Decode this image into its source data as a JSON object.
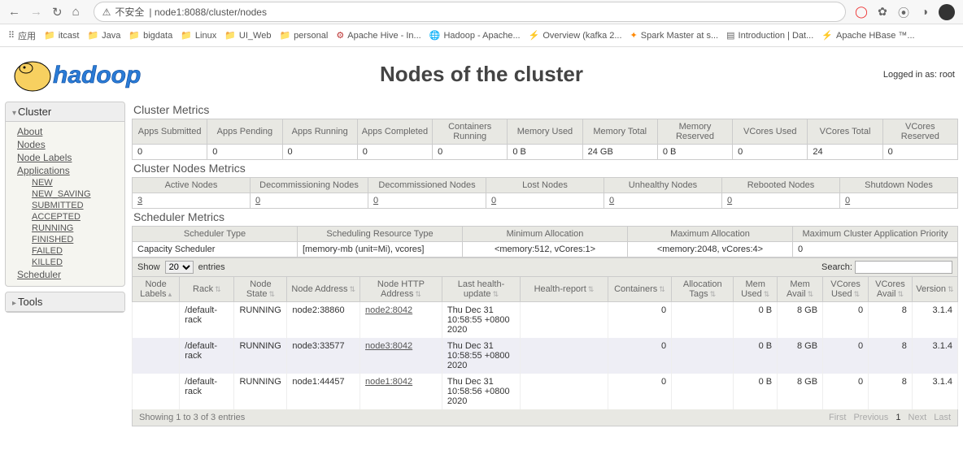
{
  "browser": {
    "url_warn_text": "不安全",
    "url": "node1:8088/cluster/nodes",
    "bookmarks_app": "应用",
    "bookmarks": [
      "itcast",
      "Java",
      "bigdata",
      "Linux",
      "UI_Web",
      "personal",
      "Apache Hive - In...",
      "Hadoop - Apache...",
      "Overview (kafka 2...",
      "Spark Master at s...",
      "Introduction | Dat...",
      "Apache HBase ™..."
    ]
  },
  "page": {
    "title": "Nodes of the cluster",
    "login": "Logged in as: root"
  },
  "sidebar": {
    "cluster_head": "Cluster",
    "cluster_links": [
      "About",
      "Nodes",
      "Node Labels",
      "Applications"
    ],
    "app_states": [
      "NEW",
      "NEW_SAVING",
      "SUBMITTED",
      "ACCEPTED",
      "RUNNING",
      "FINISHED",
      "FAILED",
      "KILLED"
    ],
    "scheduler": "Scheduler",
    "tools_head": "Tools"
  },
  "sections": {
    "cluster_metrics": "Cluster Metrics",
    "cluster_nodes": "Cluster Nodes Metrics",
    "scheduler_metrics": "Scheduler Metrics"
  },
  "cluster_metrics": {
    "headers": [
      "Apps Submitted",
      "Apps Pending",
      "Apps Running",
      "Apps Completed",
      "Containers Running",
      "Memory Used",
      "Memory Total",
      "Memory Reserved",
      "VCores Used",
      "VCores Total",
      "VCores Reserved"
    ],
    "values": [
      "0",
      "0",
      "0",
      "0",
      "0",
      "0 B",
      "24 GB",
      "0 B",
      "0",
      "24",
      "0"
    ]
  },
  "nodes_metrics": {
    "headers": [
      "Active Nodes",
      "Decommissioning Nodes",
      "Decommissioned Nodes",
      "Lost Nodes",
      "Unhealthy Nodes",
      "Rebooted Nodes",
      "Shutdown Nodes"
    ],
    "values": [
      "3",
      "0",
      "0",
      "0",
      "0",
      "0",
      "0"
    ]
  },
  "scheduler_metrics": {
    "headers": [
      "Scheduler Type",
      "Scheduling Resource Type",
      "Minimum Allocation",
      "Maximum Allocation",
      "Maximum Cluster Application Priority"
    ],
    "values": [
      "Capacity Scheduler",
      "[memory-mb (unit=Mi), vcores]",
      "<memory:512, vCores:1>",
      "<memory:2048, vCores:4>",
      "0"
    ]
  },
  "dt": {
    "show_label": "Show",
    "entries_label": "entries",
    "page_size": "20",
    "search_label": "Search:",
    "info": "Showing 1 to 3 of 3 entries",
    "paginate": {
      "first": "First",
      "prev": "Previous",
      "p1": "1",
      "next": "Next",
      "last": "Last"
    }
  },
  "nodes_table": {
    "headers": [
      "Node Labels",
      "Rack",
      "Node State",
      "Node Address",
      "Node HTTP Address",
      "Last health-update",
      "Health-report",
      "Containers",
      "Allocation Tags",
      "Mem Used",
      "Mem Avail",
      "VCores Used",
      "VCores Avail",
      "Version"
    ],
    "rows": [
      {
        "labels": "",
        "rack": "/default-rack",
        "state": "RUNNING",
        "addr": "node2:38860",
        "http": "node2:8042",
        "update": "Thu Dec 31 10:58:55 +0800 2020",
        "health": "",
        "containers": "0",
        "alloc": "",
        "memUsed": "0 B",
        "memAvail": "8 GB",
        "vcUsed": "0",
        "vcAvail": "8",
        "version": "3.1.4"
      },
      {
        "labels": "",
        "rack": "/default-rack",
        "state": "RUNNING",
        "addr": "node3:33577",
        "http": "node3:8042",
        "update": "Thu Dec 31 10:58:55 +0800 2020",
        "health": "",
        "containers": "0",
        "alloc": "",
        "memUsed": "0 B",
        "memAvail": "8 GB",
        "vcUsed": "0",
        "vcAvail": "8",
        "version": "3.1.4"
      },
      {
        "labels": "",
        "rack": "/default-rack",
        "state": "RUNNING",
        "addr": "node1:44457",
        "http": "node1:8042",
        "update": "Thu Dec 31 10:58:56 +0800 2020",
        "health": "",
        "containers": "0",
        "alloc": "",
        "memUsed": "0 B",
        "memAvail": "8 GB",
        "vcUsed": "0",
        "vcAvail": "8",
        "version": "3.1.4"
      }
    ]
  }
}
